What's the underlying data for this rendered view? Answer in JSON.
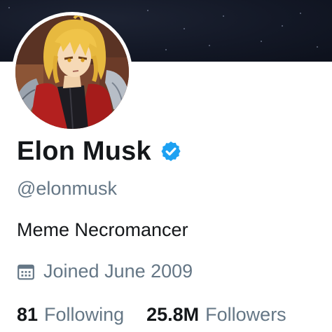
{
  "profile": {
    "display_name": "Elon Musk",
    "verified": true,
    "handle": "@elonmusk",
    "bio": "Meme Necromancer",
    "joined": "Joined June 2009"
  },
  "stats": {
    "following": {
      "count": "81",
      "label": "Following"
    },
    "followers": {
      "count": "25.8M",
      "label": "Followers"
    }
  },
  "icons": {
    "verified_badge": "verified-badge-icon",
    "calendar": "calendar-icon"
  },
  "colors": {
    "text_primary": "#14171a",
    "text_secondary": "#657786",
    "verified_blue": "#1da1f2",
    "banner_dark": "#131826"
  }
}
